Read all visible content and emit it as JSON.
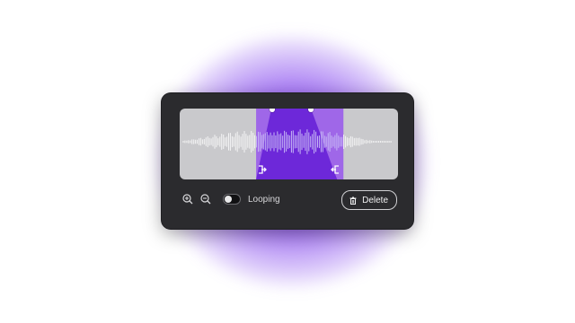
{
  "loop_toggle": {
    "label": "Looping",
    "state": "off"
  },
  "actions": {
    "delete_label": "Delete"
  },
  "zoom": {
    "in_icon": "zoom-in-icon",
    "out_icon": "zoom-out-icon"
  },
  "selection": {
    "start_fraction": 0.35,
    "end_fraction": 0.75,
    "start_marker_icon": "marker-in-icon",
    "end_marker_icon": "marker-out-icon"
  },
  "colors": {
    "accent": "#6d28d9",
    "selection_light": "#9f67e8",
    "panel": "#2b2b2e",
    "waveform_bg": "#c9c9cc"
  }
}
